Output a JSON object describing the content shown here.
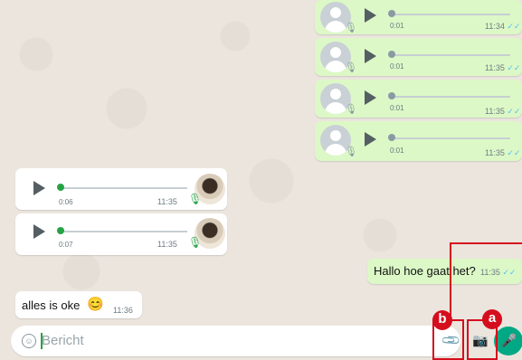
{
  "voice_out": [
    {
      "duration": "0:01",
      "time": "11:34"
    },
    {
      "duration": "0:01",
      "time": "11:35"
    },
    {
      "duration": "0:01",
      "time": "11:35"
    },
    {
      "duration": "0:01",
      "time": "11:35"
    }
  ],
  "voice_in": [
    {
      "duration": "0:06",
      "time": "11:35"
    },
    {
      "duration": "0:07",
      "time": "11:35"
    }
  ],
  "text_out": {
    "text": "Hallo hoe gaat het?",
    "time": "11:35"
  },
  "text_in": {
    "text": "alles is oke",
    "emoji": "😊",
    "time": "11:36"
  },
  "composer": {
    "placeholder": "Bericht"
  },
  "annotations": {
    "a": "a",
    "b": "b"
  },
  "icons": {
    "read_ticks": "✓✓",
    "emoji": "☺",
    "attach": "📎",
    "camera": "📷",
    "mic": "🎤"
  },
  "colors": {
    "outgoing": "#dcf8c6",
    "incoming": "#ffffff",
    "accent": "#00a884",
    "highlight": "#d40e1d",
    "ticks": "#4fc3f7"
  }
}
